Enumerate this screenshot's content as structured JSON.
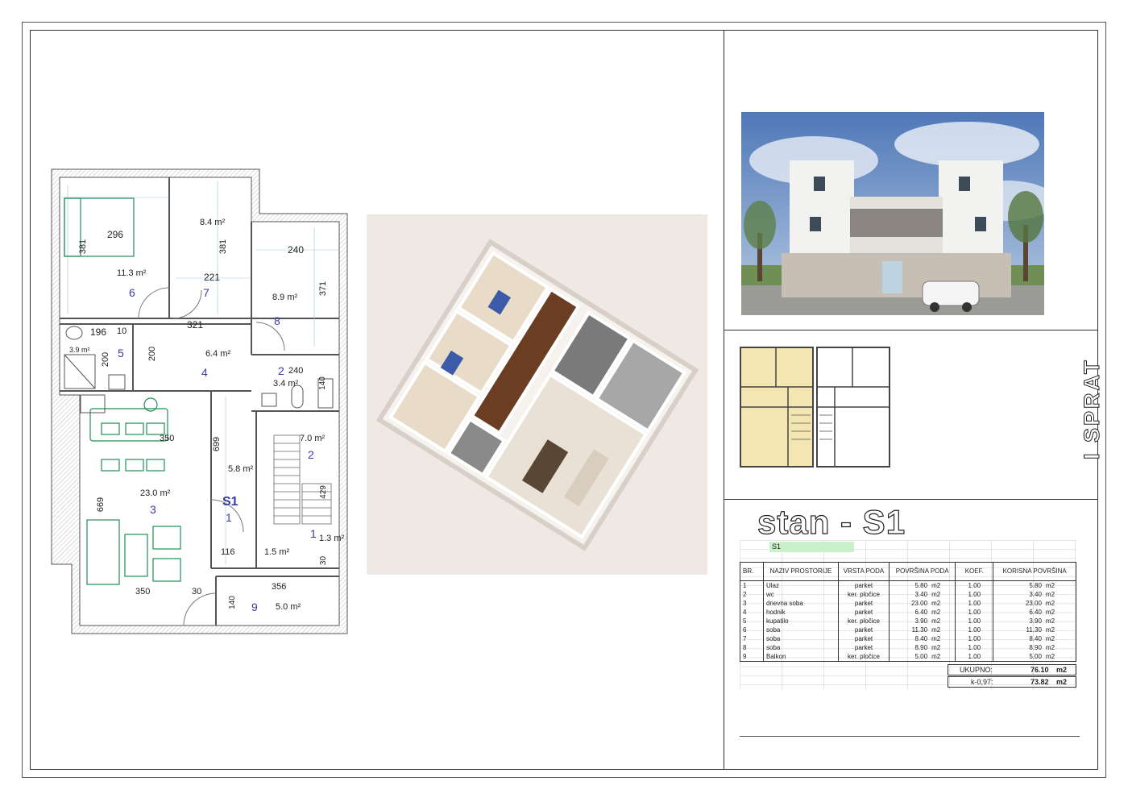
{
  "sheet": {
    "sprat_label": "I SPRAT",
    "title": "stan - S1",
    "tag": "S1"
  },
  "plan": {
    "rooms": [
      {
        "num": "6",
        "area": "11.3 m²",
        "dim_a": "296",
        "dim_b": "381"
      },
      {
        "num": "7",
        "area": "8.4 m²",
        "dim_a": "221",
        "dim_b": "381"
      },
      {
        "num": "8",
        "area": "8.9 m²",
        "dim_a": "240",
        "dim_b": "371"
      },
      {
        "num": "5",
        "area": "3.9 m²",
        "dim_a": "196",
        "dim_b": "200"
      },
      {
        "num": "4",
        "area": "6.4 m²",
        "dim_a": "321",
        "dim_b": "200"
      },
      {
        "num": "2",
        "area": "3.4 m²",
        "dim_a": "240",
        "dim_b": "140"
      },
      {
        "num": "3",
        "area": "23.0 m²",
        "dim_a": "350",
        "dim_b": "669"
      },
      {
        "num": "1",
        "area": "5.8 m²",
        "dim_a": "116",
        "dim_b": "699"
      },
      {
        "num": "9",
        "area": "5.0 m²",
        "dim_a": "356",
        "dim_b": "140"
      }
    ],
    "stair_area": "7.0 m²",
    "stair_num": "2",
    "stair_dim": "429",
    "small1_area": "1.5 m²",
    "small2_area": "1.3 m²",
    "small2_num": "1",
    "dim_10": "10",
    "dim_30a": "30",
    "dim_30b": "30",
    "unit_label": "S1",
    "unit_num": "1"
  },
  "table": {
    "headers": [
      "BR.",
      "NAZIV PROSTORIJE",
      "VRSTA PODA",
      "POVRŠINA PODA",
      "KOEF.",
      "KORISNA POVRŠINA"
    ],
    "rows": [
      [
        "1",
        "Ulaz",
        "parket",
        "5.80",
        "m2",
        "1.00",
        "5.80",
        "m2"
      ],
      [
        "2",
        "wc",
        "ker. pločice",
        "3.40",
        "m2",
        "1.00",
        "3.40",
        "m2"
      ],
      [
        "3",
        "dnevna soba",
        "parket",
        "23.00",
        "m2",
        "1.00",
        "23.00",
        "m2"
      ],
      [
        "4",
        "hodnik",
        "parket",
        "6.40",
        "m2",
        "1.00",
        "6.40",
        "m2"
      ],
      [
        "5",
        "kupatilo",
        "ker. pločice",
        "3.90",
        "m2",
        "1.00",
        "3.90",
        "m2"
      ],
      [
        "6",
        "soba",
        "parket",
        "11.30",
        "m2",
        "1.00",
        "11.30",
        "m2"
      ],
      [
        "7",
        "soba",
        "parket",
        "8.40",
        "m2",
        "1.00",
        "8.40",
        "m2"
      ],
      [
        "8",
        "soba",
        "parket",
        "8.90",
        "m2",
        "1.00",
        "8.90",
        "m2"
      ],
      [
        "9",
        "Balkon",
        "ker. pločice",
        "5.00",
        "m2",
        "1.00",
        "5.00",
        "m2"
      ]
    ],
    "total_label": "UKUPNO:",
    "total_value": "76.10",
    "total_unit": "m2",
    "k_label": "k-0,97:",
    "k_value": "73.82",
    "k_unit": "m2"
  },
  "colors": {
    "room_number": "#3a3aa8",
    "furniture": "#1f8f55",
    "key_plan_fill": "#f3e6b3"
  }
}
